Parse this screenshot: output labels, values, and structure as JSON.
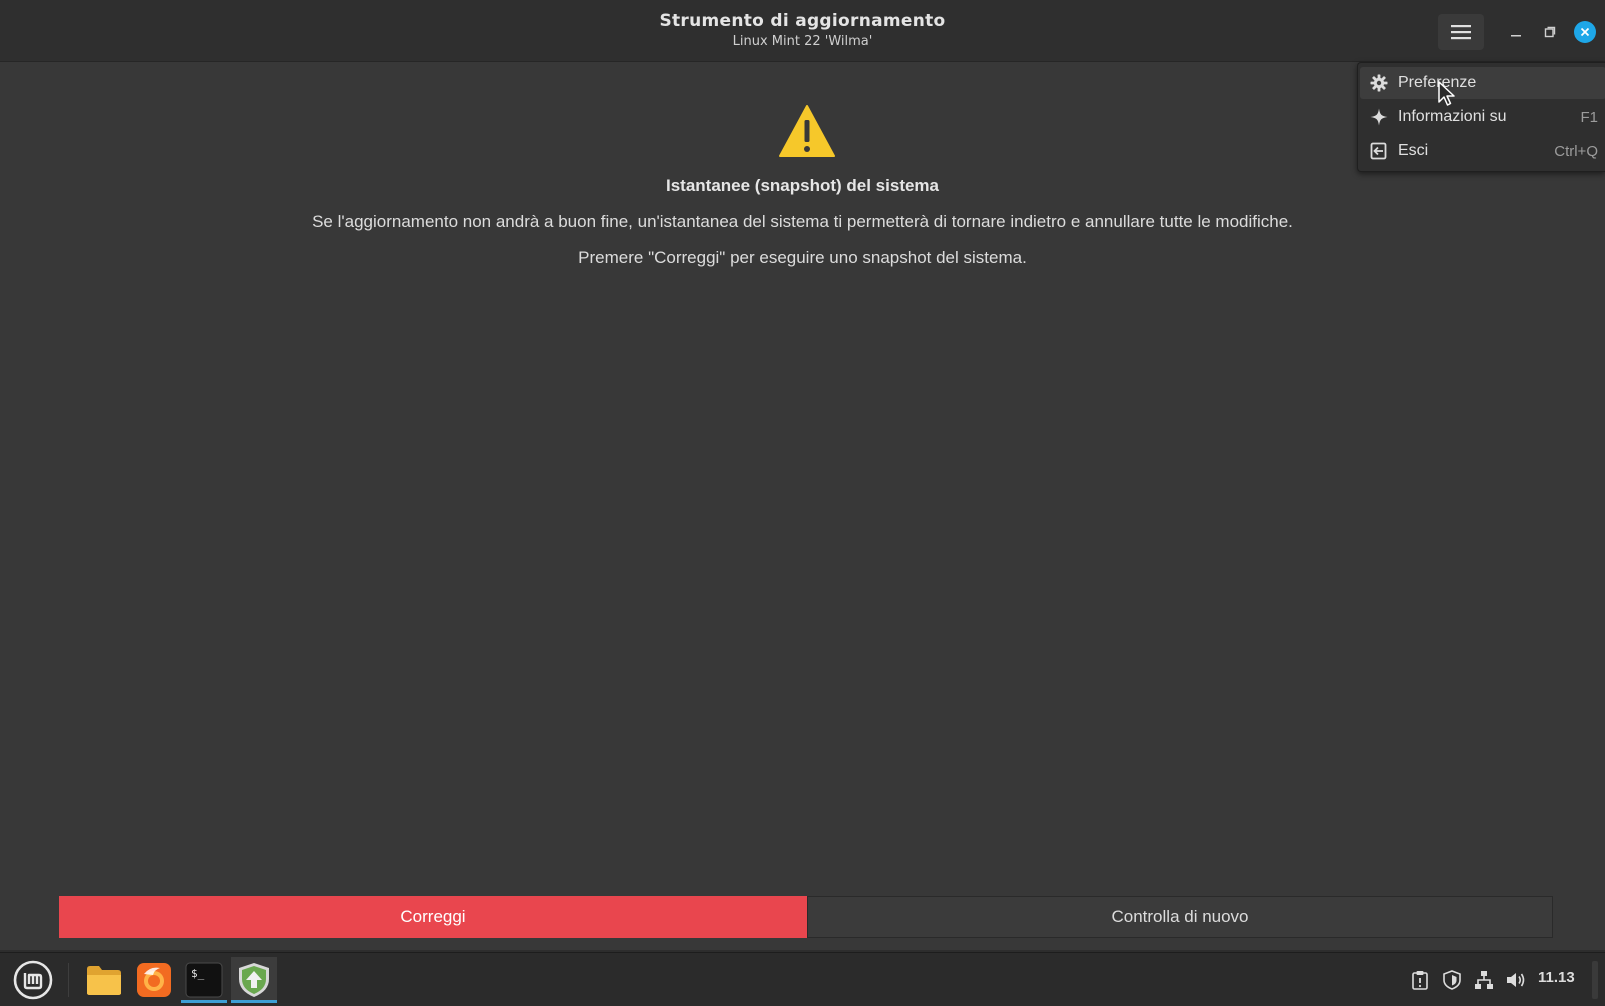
{
  "window": {
    "title": "Strumento di aggiornamento",
    "subtitle": "Linux Mint 22 'Wilma'",
    "menu_icon": "hamburger-menu-icon",
    "controls": [
      "minimize-icon",
      "maximize-icon",
      "close-icon"
    ]
  },
  "message": {
    "icon": "warning-icon",
    "heading": "Istantanee (snapshot) del sistema",
    "line1": "Se l'aggiornamento non andrà a buon fine, un'istantanea del sistema ti permetterà di tornare indietro e annullare tutte le modifiche.",
    "line2": "Premere \"Correggi\" per eseguire uno snapshot del sistema."
  },
  "actions": {
    "fix_label": "Correggi",
    "check_label": "Controlla di nuovo",
    "fix_color": "#e9464e"
  },
  "popup_menu": {
    "items": [
      {
        "label": "Preferenze",
        "icon": "gear-icon",
        "shortcut": ""
      },
      {
        "label": "Informazioni su",
        "icon": "star-icon",
        "shortcut": "F1"
      },
      {
        "label": "Esci",
        "icon": "exit-icon",
        "shortcut": "Ctrl+Q"
      }
    ]
  },
  "taskbar": {
    "apps": [
      "mint-menu-icon",
      "files-folder-icon",
      "firefox-icon",
      "terminal-icon",
      "update-manager-icon"
    ],
    "tray": [
      "clipboard-icon",
      "shield-icon",
      "network-icon",
      "volume-icon"
    ],
    "clock": "11.13",
    "accent": "#3d9fd5"
  }
}
